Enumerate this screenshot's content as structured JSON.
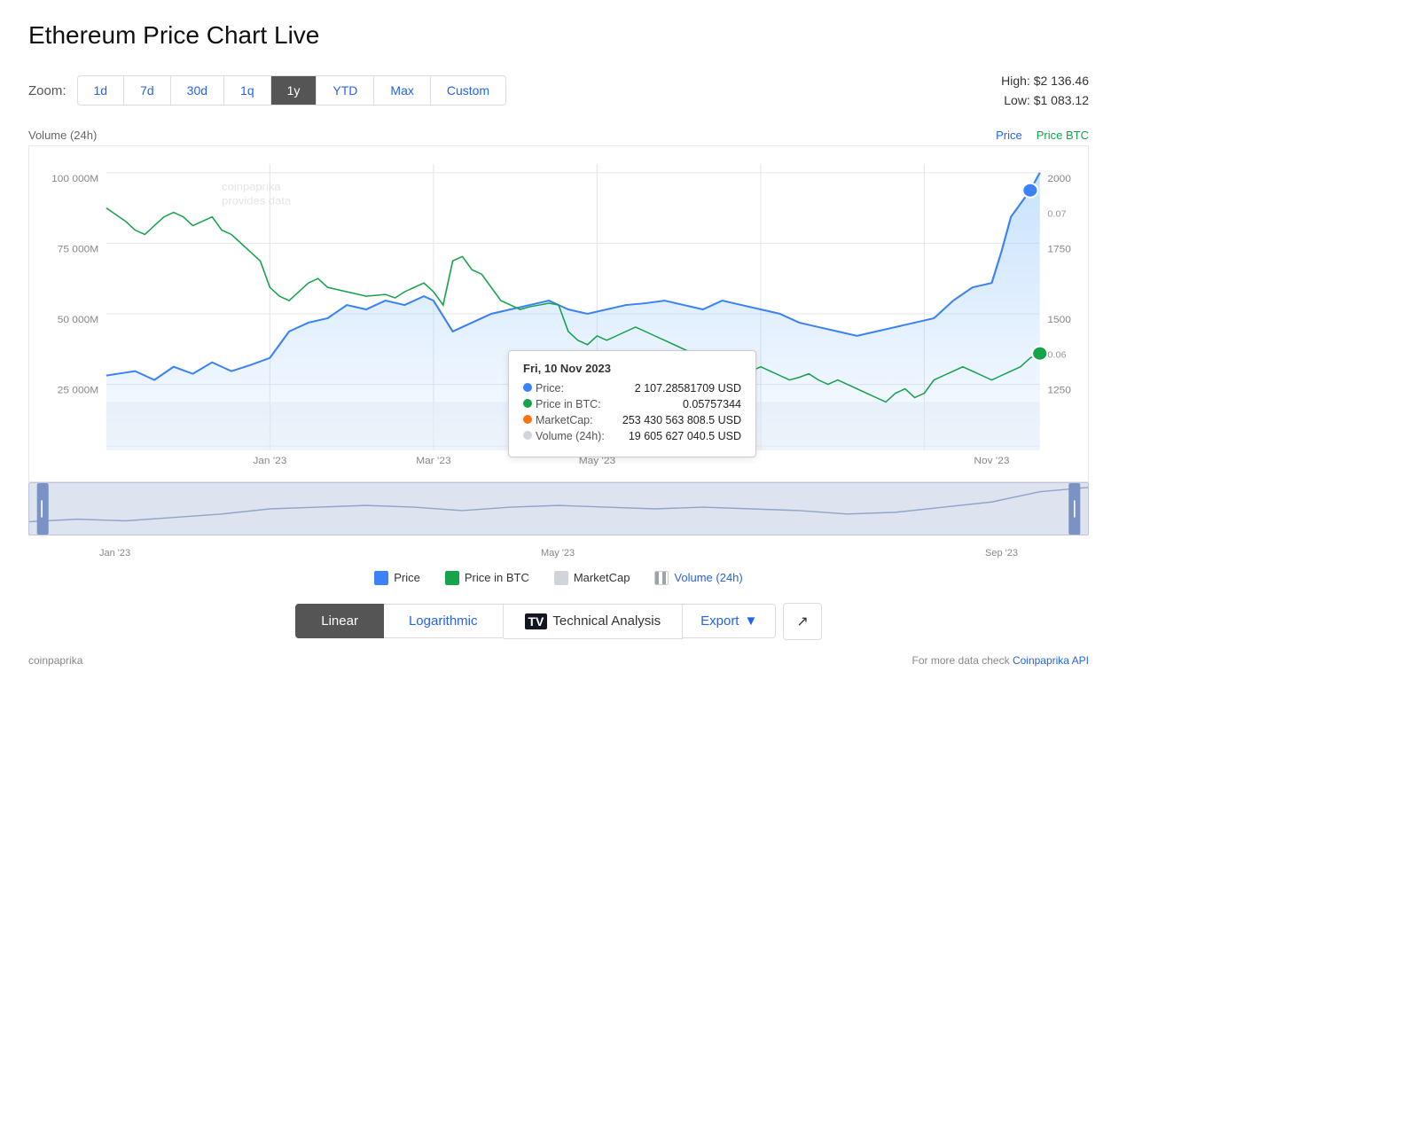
{
  "page": {
    "title": "Ethereum Price Chart Live"
  },
  "zoom": {
    "label": "Zoom:",
    "buttons": [
      "1d",
      "7d",
      "30d",
      "1q",
      "1y",
      "YTD",
      "Max",
      "Custom"
    ],
    "active": "1y"
  },
  "high_low": {
    "high": "High: $2 136.46",
    "low": "Low: $1 083.12"
  },
  "chart": {
    "volume_label": "Volume (24h)",
    "price_label": "Price",
    "pricebtc_label": "Price BTC",
    "y_left": [
      "100 000M",
      "75 000M",
      "50 000M",
      "25 000M"
    ],
    "y_right": [
      "2000",
      "1750",
      "1500",
      "1250"
    ],
    "y_right_btc": [
      "0.07",
      "",
      "0.06"
    ],
    "x_labels": [
      "Jan '23",
      "Mar '23",
      "May '23",
      "Nov '23"
    ],
    "watermark_line1": "coinpaprika",
    "watermark_line2": "provides data"
  },
  "tooltip": {
    "date": "Fri, 10 Nov 2023",
    "rows": [
      {
        "key": "Price:",
        "value": "2 107.28581709 USD",
        "dot": "blue"
      },
      {
        "key": "Price in BTC:",
        "value": "0.05757344",
        "dot": "green"
      },
      {
        "key": "MarketCap:",
        "value": "253 430 563 808.5 USD",
        "dot": "orange"
      },
      {
        "key": "Volume (24h):",
        "value": "19 605 627 040.5 USD",
        "dot": "gray"
      }
    ]
  },
  "range_slider": {
    "x_labels": [
      "Jan '23",
      "May '23",
      "Sep '23"
    ]
  },
  "legend": [
    {
      "label": "Price",
      "type": "blue"
    },
    {
      "label": "Price in BTC",
      "type": "green"
    },
    {
      "label": "MarketCap",
      "type": "gray"
    },
    {
      "label": "Volume (24h)",
      "type": "stripe"
    }
  ],
  "controls": {
    "linear": "Linear",
    "logarithmic": "Logarithmic",
    "technical": "Technical Analysis",
    "export": "Export",
    "expand": "↗"
  },
  "footer": {
    "left": "coinpaprika",
    "right_text": "For more data check ",
    "right_link": "Coinpaprika API"
  }
}
